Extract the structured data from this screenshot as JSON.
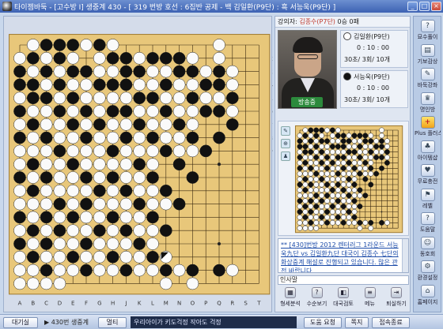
{
  "window": {
    "title": "타이젬바둑 - [고수방 I]  생중계 430 - [ 319 번방  호선 : 6집반 공제  - 백 김일환(P9단) : 흑 서능욱(P9단) ]",
    "buttons": [
      "_",
      "□",
      "×"
    ]
  },
  "board": {
    "size": 19,
    "col_labels": [
      "A",
      "B",
      "C",
      "D",
      "E",
      "F",
      "G",
      "H",
      "J",
      "K",
      "L",
      "M",
      "N",
      "O",
      "P",
      "Q",
      "R",
      "S",
      "T"
    ],
    "row_labels": [
      "1",
      "2",
      "3",
      "4",
      "5",
      "6",
      "7",
      "8",
      "9",
      "10",
      "11",
      "12",
      "13",
      "14",
      "15",
      "16",
      "17",
      "18",
      "19"
    ],
    "black_stones": [
      [
        3,
        1
      ],
      [
        4,
        1
      ],
      [
        5,
        1
      ],
      [
        7,
        1
      ],
      [
        2,
        2
      ],
      [
        4,
        2
      ],
      [
        8,
        2
      ],
      [
        9,
        2
      ],
      [
        11,
        2
      ],
      [
        12,
        2
      ],
      [
        13,
        2
      ],
      [
        1,
        3
      ],
      [
        3,
        3
      ],
      [
        5,
        3
      ],
      [
        6,
        3
      ],
      [
        9,
        3
      ],
      [
        10,
        3
      ],
      [
        13,
        3
      ],
      [
        14,
        3
      ],
      [
        16,
        3
      ],
      [
        1,
        4
      ],
      [
        2,
        4
      ],
      [
        4,
        4
      ],
      [
        7,
        4
      ],
      [
        8,
        4
      ],
      [
        9,
        4
      ],
      [
        12,
        4
      ],
      [
        15,
        4
      ],
      [
        16,
        4
      ],
      [
        2,
        5
      ],
      [
        3,
        5
      ],
      [
        5,
        5
      ],
      [
        10,
        5
      ],
      [
        11,
        5
      ],
      [
        14,
        5
      ],
      [
        17,
        5
      ],
      [
        1,
        6
      ],
      [
        4,
        6
      ],
      [
        6,
        6
      ],
      [
        8,
        6
      ],
      [
        9,
        6
      ],
      [
        12,
        6
      ],
      [
        15,
        6
      ],
      [
        16,
        6
      ],
      [
        2,
        7
      ],
      [
        5,
        7
      ],
      [
        7,
        7
      ],
      [
        10,
        7
      ],
      [
        13,
        7
      ],
      [
        17,
        7
      ],
      [
        1,
        8
      ],
      [
        3,
        8
      ],
      [
        6,
        8
      ],
      [
        9,
        8
      ],
      [
        11,
        8
      ],
      [
        14,
        8
      ],
      [
        16,
        8
      ],
      [
        4,
        9
      ],
      [
        8,
        9
      ],
      [
        12,
        9
      ],
      [
        15,
        9
      ],
      [
        2,
        10
      ],
      [
        5,
        10
      ],
      [
        10,
        10
      ],
      [
        13,
        10
      ],
      [
        1,
        11
      ],
      [
        3,
        11
      ],
      [
        6,
        11
      ],
      [
        8,
        11
      ],
      [
        11,
        11
      ],
      [
        14,
        11
      ],
      [
        2,
        12
      ],
      [
        7,
        12
      ],
      [
        9,
        12
      ],
      [
        12,
        12
      ],
      [
        4,
        13
      ],
      [
        6,
        13
      ],
      [
        10,
        13
      ],
      [
        13,
        13
      ],
      [
        1,
        14
      ],
      [
        3,
        14
      ],
      [
        5,
        14
      ],
      [
        8,
        14
      ],
      [
        11,
        14
      ],
      [
        2,
        15
      ],
      [
        4,
        15
      ],
      [
        7,
        15
      ],
      [
        9,
        15
      ],
      [
        12,
        15
      ],
      [
        1,
        16
      ],
      [
        3,
        16
      ],
      [
        6,
        16
      ],
      [
        10,
        16
      ],
      [
        2,
        17
      ],
      [
        5,
        17
      ],
      [
        8,
        17
      ],
      [
        11,
        17
      ],
      [
        3,
        18
      ],
      [
        6,
        18
      ],
      [
        9,
        18
      ],
      [
        12,
        18
      ],
      [
        14,
        18
      ],
      [
        16,
        18
      ]
    ],
    "white_stones": [
      [
        2,
        1
      ],
      [
        6,
        1
      ],
      [
        8,
        1
      ],
      [
        16,
        1
      ],
      [
        1,
        2
      ],
      [
        3,
        2
      ],
      [
        5,
        2
      ],
      [
        7,
        2
      ],
      [
        10,
        2
      ],
      [
        14,
        2
      ],
      [
        16,
        2
      ],
      [
        2,
        3
      ],
      [
        4,
        3
      ],
      [
        7,
        3
      ],
      [
        8,
        3
      ],
      [
        11,
        3
      ],
      [
        12,
        3
      ],
      [
        15,
        3
      ],
      [
        17,
        3
      ],
      [
        3,
        4
      ],
      [
        5,
        4
      ],
      [
        6,
        4
      ],
      [
        10,
        4
      ],
      [
        11,
        4
      ],
      [
        13,
        4
      ],
      [
        14,
        4
      ],
      [
        17,
        4
      ],
      [
        1,
        5
      ],
      [
        4,
        5
      ],
      [
        6,
        5
      ],
      [
        7,
        5
      ],
      [
        8,
        5
      ],
      [
        9,
        5
      ],
      [
        12,
        5
      ],
      [
        13,
        5
      ],
      [
        15,
        5
      ],
      [
        16,
        5
      ],
      [
        2,
        6
      ],
      [
        3,
        6
      ],
      [
        5,
        6
      ],
      [
        7,
        6
      ],
      [
        10,
        6
      ],
      [
        11,
        6
      ],
      [
        13,
        6
      ],
      [
        14,
        6
      ],
      [
        17,
        6
      ],
      [
        1,
        7
      ],
      [
        3,
        7
      ],
      [
        4,
        7
      ],
      [
        6,
        7
      ],
      [
        8,
        7
      ],
      [
        9,
        7
      ],
      [
        11,
        7
      ],
      [
        12,
        7
      ],
      [
        14,
        7
      ],
      [
        2,
        8
      ],
      [
        4,
        8
      ],
      [
        5,
        8
      ],
      [
        7,
        8
      ],
      [
        8,
        8
      ],
      [
        10,
        8
      ],
      [
        12,
        8
      ],
      [
        13,
        8
      ],
      [
        1,
        9
      ],
      [
        2,
        9
      ],
      [
        3,
        9
      ],
      [
        5,
        9
      ],
      [
        6,
        9
      ],
      [
        7,
        9
      ],
      [
        9,
        9
      ],
      [
        10,
        9
      ],
      [
        11,
        9
      ],
      [
        13,
        9
      ],
      [
        14,
        9
      ],
      [
        1,
        10
      ],
      [
        3,
        10
      ],
      [
        4,
        10
      ],
      [
        6,
        10
      ],
      [
        7,
        10
      ],
      [
        8,
        10
      ],
      [
        9,
        10
      ],
      [
        11,
        10
      ],
      [
        2,
        11
      ],
      [
        4,
        11
      ],
      [
        5,
        11
      ],
      [
        7,
        11
      ],
      [
        9,
        11
      ],
      [
        10,
        11
      ],
      [
        1,
        12
      ],
      [
        3,
        12
      ],
      [
        4,
        12
      ],
      [
        5,
        12
      ],
      [
        6,
        12
      ],
      [
        8,
        12
      ],
      [
        10,
        12
      ],
      [
        11,
        12
      ],
      [
        1,
        13
      ],
      [
        2,
        13
      ],
      [
        3,
        13
      ],
      [
        5,
        13
      ],
      [
        7,
        13
      ],
      [
        8,
        13
      ],
      [
        9,
        13
      ],
      [
        11,
        13
      ],
      [
        12,
        13
      ],
      [
        2,
        14
      ],
      [
        4,
        14
      ],
      [
        6,
        14
      ],
      [
        7,
        14
      ],
      [
        9,
        14
      ],
      [
        10,
        14
      ],
      [
        1,
        15
      ],
      [
        3,
        15
      ],
      [
        5,
        15
      ],
      [
        6,
        15
      ],
      [
        8,
        15
      ],
      [
        10,
        15
      ],
      [
        11,
        15
      ],
      [
        2,
        16
      ],
      [
        4,
        16
      ],
      [
        5,
        16
      ],
      [
        7,
        16
      ],
      [
        8,
        16
      ],
      [
        9,
        16
      ],
      [
        11,
        16
      ],
      [
        1,
        17
      ],
      [
        3,
        17
      ],
      [
        4,
        17
      ],
      [
        6,
        17
      ],
      [
        7,
        17
      ],
      [
        9,
        17
      ],
      [
        10,
        17
      ],
      [
        1,
        18
      ],
      [
        2,
        18
      ],
      [
        4,
        18
      ],
      [
        5,
        18
      ],
      [
        7,
        18
      ],
      [
        8,
        18
      ],
      [
        10,
        18
      ],
      [
        11,
        18
      ],
      [
        13,
        18
      ],
      [
        17,
        18
      ],
      [
        1,
        19
      ],
      [
        2,
        19
      ],
      [
        3,
        19
      ],
      [
        4,
        19
      ],
      [
        12,
        19
      ],
      [
        14,
        19
      ]
    ],
    "last_move": [
      12,
      17
    ]
  },
  "lecture": {
    "label": "강의자:",
    "lecturer_name": "김종수(P7단)",
    "record": "0승 0패",
    "live_label": "방송중"
  },
  "players": [
    {
      "color": "white",
      "name": "김일환(P9단)",
      "time": "0 : 10 : 00",
      "rule": "30초/ 3회/   10개"
    },
    {
      "color": "black",
      "name": "서능욱(P9단)",
      "time": "0 : 10 : 00",
      "rule": "30초/ 3회/   10개"
    }
  ],
  "chat": {
    "text": "** [430]번방 2012 렌터러그 1라운드 서능욱九단 vs 김일환九단 대국이 김종수 七단의 화상중계 해설로 진행되고 있습니다. 많은 관전 바랍니다.",
    "input_label": "인사말"
  },
  "tools": [
    "형세분석",
    "수순보기",
    "대국검토",
    "메뉴",
    "퇴실하기"
  ],
  "sidebar": [
    "묘수풀이",
    "기보감상",
    "바둑강좌",
    "명인방",
    "Plus 플러스",
    "아이템샵",
    "무료충전",
    "레벨",
    "도움말",
    "동호회",
    "환경설정",
    "홈페이지"
  ],
  "statusbar": {
    "waiting": "대기실",
    "room": "430번 생중계",
    "multi": "멀티",
    "marquee": "우리아이가 키도걱정 작아도 걱정",
    "help_btn": "도움 요청",
    "note_btn": "쪽지",
    "end_btn": "접속종료"
  },
  "colors": {
    "board": "#e8c77a",
    "accent": "#3d62b3"
  }
}
